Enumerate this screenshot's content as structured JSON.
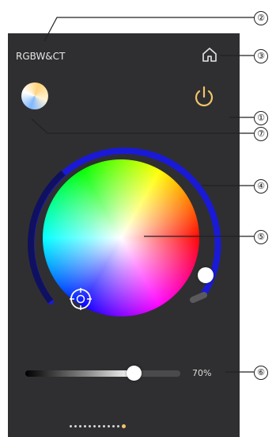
{
  "header": {
    "title": "RGBW&CT"
  },
  "icons": {
    "home": "home-icon",
    "power": "power-icon",
    "picker": "crosshair-icon"
  },
  "brightness": {
    "value_text": "70%",
    "level": 0.7
  },
  "pager": {
    "dot_count": 12,
    "active_index": 11
  },
  "callouts": {
    "c1": "①",
    "c2": "②",
    "c3": "③",
    "c4": "④",
    "c5": "⑤",
    "c6": "⑥",
    "c7": "⑦"
  },
  "colors": {
    "background": "#2f2f31",
    "power": "#f1c46a",
    "ring_active": "#1a1ad6",
    "ring_inactive": "#4a4a4c"
  }
}
